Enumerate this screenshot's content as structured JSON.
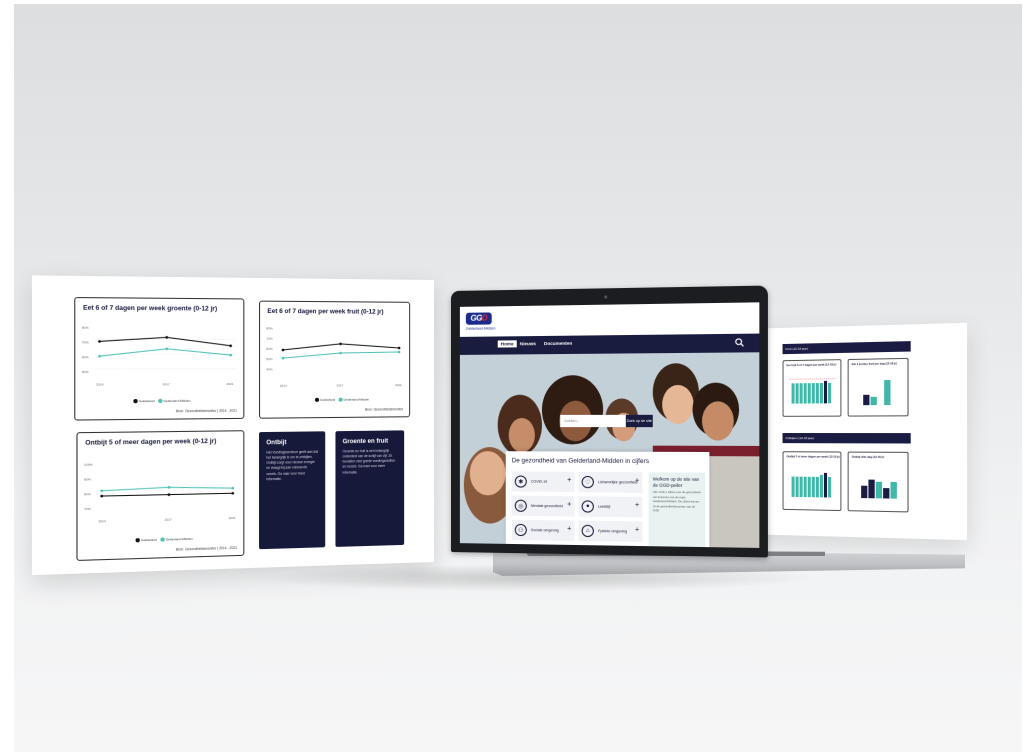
{
  "left_panel": {
    "cards": [
      {
        "title": "Eet 6 of 7 dagen per week groente (0-12 jr)",
        "years": [
          "2014",
          "2017",
          "2021"
        ],
        "yticks": [
          "80%",
          "70%",
          "60%",
          "50%",
          "40%"
        ],
        "legend": [
          "Gelderland",
          "Gelderland-Midden"
        ],
        "source": "Bron: Gezondheidsmonitor | 2014 - 2021"
      },
      {
        "title": "Eet 6 of 7 dagen per week fruit (0-12 jr)",
        "years": [
          "2014",
          "2017",
          "2021"
        ],
        "yticks": [
          "80%",
          "70%",
          "60%",
          "50%",
          "40%"
        ],
        "legend": [
          "Gelderland",
          "Gelderland-Midden"
        ],
        "source": "Bron: Gezondheidsmonitor"
      },
      {
        "title": "Ontbijt 5 of meer dagen per week (0-12 jr)",
        "years": [
          "2014",
          "2017",
          "2021"
        ],
        "yticks": [
          "100%",
          "90%",
          "80%",
          "70%"
        ],
        "legend": [
          "Gelderland",
          "Gelderland-Midden"
        ],
        "source": "Bron: Gezondheidsmonitor | 2014 - 2021"
      }
    ],
    "info_cards": [
      {
        "title": "Ontbijt",
        "text": "Het Voedingscentrum geeft aan dat het belangrijk is om te ontbijten. Ontbijt zorgt voor nieuwe energie en draagt bij aan voldoende vezels. Ga naar voor meer informatie."
      },
      {
        "title": "Groente en fruit",
        "text": "Groente en fruit is een belangrijk onderdeel van de schijf van vijf. Ze bevatten veel goede voedingsstoffen en vezels. Ga naar voor meer informatie."
      }
    ],
    "colors": {
      "navy": "#17193b",
      "teal": "#4fc1b5",
      "black": "#111111"
    }
  },
  "laptop": {
    "logo": {
      "g1": "GG",
      "d": "D"
    },
    "tagline": "Gelderland-Midden",
    "nav": [
      "Home",
      "Nieuws",
      "Documenten"
    ],
    "search": {
      "placeholder": "Zoeken...",
      "button": "Zoek op de site"
    },
    "section_title": "De gezondheid van Gelderland-Midden in cijfers",
    "tiles": [
      {
        "label": "COVID-19",
        "icon": "virus-icon"
      },
      {
        "label": "Lichamelijke gezondheid",
        "icon": "heart-icon"
      },
      {
        "label": "Mentale gezondheid",
        "icon": "brain-icon"
      },
      {
        "label": "Leefstijl",
        "icon": "apple-icon"
      },
      {
        "label": "Sociale omgeving",
        "icon": "people-icon"
      },
      {
        "label": "Fysieke omgeving",
        "icon": "house-icon"
      }
    ],
    "side": {
      "title": "Welkom op de site van de GGD-peiler",
      "text": "Hier vindt u cijfers over de gezondheid van inwoners van de regio Gelderland-Midden. De cijfers komen uit de gezondheidsmonitor van de GGD."
    }
  },
  "right_panel": {
    "header1": "Fruit (12-18 jaar)",
    "header2": "Ontbijten (12-18 jaar)",
    "cards": [
      {
        "title": "Eet fruit 6 of 7 dagen per week (12-18 jr)"
      },
      {
        "title": "Eet 4 porties fruit per dag (12-18 jr)"
      },
      {
        "title": "Ontbijt 5 of meer dagen per week (12-18 jr)"
      },
      {
        "title": "Ontbijt elke dag (12-18 jr)"
      }
    ],
    "colors": {
      "teal": "#3fb7a9",
      "navy": "#1a1c44"
    }
  }
}
